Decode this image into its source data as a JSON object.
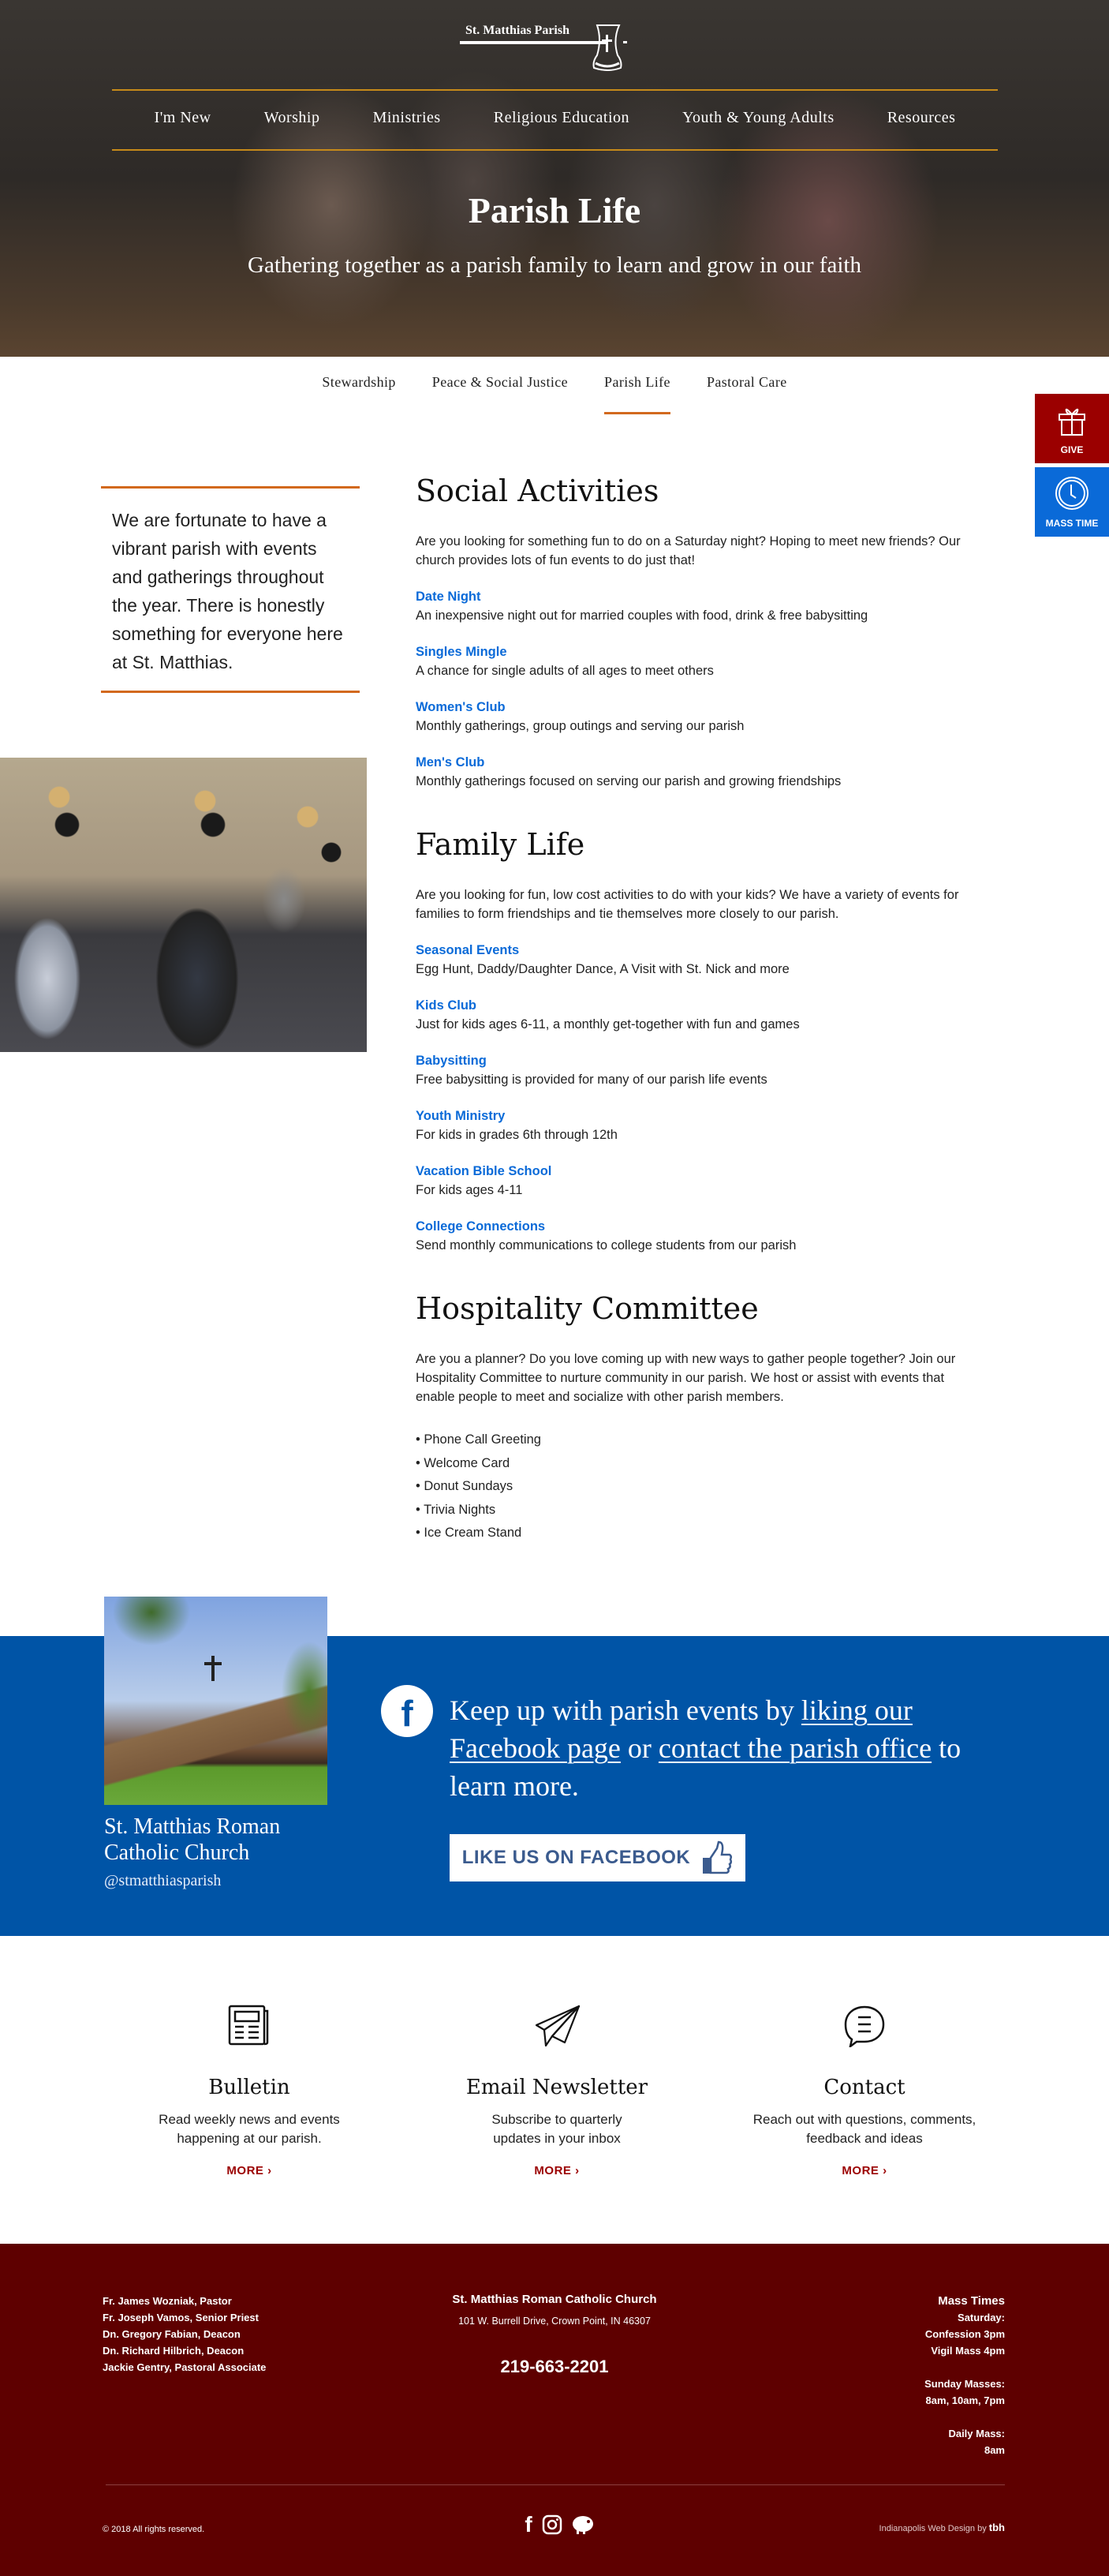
{
  "logo": {
    "text": "St. Matthias Parish"
  },
  "main_nav": [
    "I'm New",
    "Worship",
    "Ministries",
    "Religious Education",
    "Youth & Young Adults",
    "Resources"
  ],
  "hero": {
    "title": "Parish Life",
    "subtitle": "Gathering together as a parish family to learn and grow in our faith"
  },
  "sub_nav": {
    "items": [
      "Stewardship",
      "Peace & Social Justice",
      "Parish Life",
      "Pastoral Care"
    ],
    "active": "Parish Life"
  },
  "side_buttons": {
    "give": "GIVE",
    "mass_time": "MASS TIME"
  },
  "colors": {
    "give": "#9b0000",
    "mass_time": "#0a6ad8",
    "accent": "#d2691e",
    "link": "#0a6ad8",
    "fb_band": "#0054a6",
    "footer": "#5e0000"
  },
  "quote": "We are fortunate to have a vibrant parish with events and gatherings throughout the year. There is honestly something for everyone here at St. Matthias.",
  "sections": [
    {
      "title": "Social Activities",
      "intro": "Are you looking for something fun to do on a Saturday night? Hoping to meet new friends? Our church provides lots of fun events to do just that!",
      "items": [
        {
          "title": "Date Night",
          "desc": "An inexpensive night out for married couples with food, drink & free babysitting"
        },
        {
          "title": "Singles Mingle",
          "desc": "A chance for single adults of all ages to meet others"
        },
        {
          "title": "Women's Club",
          "desc": "Monthly gatherings, group outings and serving our parish"
        },
        {
          "title": "Men's Club",
          "desc": "Monthly gatherings focused on serving our parish and growing friendships"
        }
      ]
    },
    {
      "title": "Family Life",
      "intro": "Are you looking for fun, low cost activities to do with your kids? We have a variety of events for families to form friendships and tie themselves more closely to our parish.",
      "items": [
        {
          "title": "Seasonal Events",
          "desc": "Egg Hunt, Daddy/Daughter Dance, A Visit with St. Nick and more"
        },
        {
          "title": "Kids Club",
          "desc": "Just for kids ages 6-11, a monthly get-together with fun and games"
        },
        {
          "title": "Babysitting",
          "desc": "Free babysitting is provided for many of our parish life events"
        },
        {
          "title": "Youth Ministry",
          "desc": "For kids in grades 6th through 12th"
        },
        {
          "title": "Vacation Bible School",
          "desc": "For kids ages 4-11"
        },
        {
          "title": "College Connections",
          "desc": "Send monthly communications to college students from our parish"
        }
      ]
    },
    {
      "title": "Hospitality Committee",
      "intro": "Are you a planner? Do you love coming up with new ways to gather people together? Join our Hospitality Committee to nurture community in our parish. We host or assist with events that enable people to meet and socialize with other parish members.",
      "bullets": [
        "• Phone Call Greeting",
        "• Welcome Card",
        "• Donut Sundays",
        "• Trivia Nights",
        "• Ice Cream Stand"
      ]
    }
  ],
  "facebook": {
    "church_name": "St. Matthias Roman Catholic Church",
    "handle": "@stmatthiasparish",
    "text_1": "Keep up with parish events by ",
    "link_1": "liking our Facebook page",
    "text_2": " or ",
    "link_2": "contact the parish office",
    "text_3": " to learn more.",
    "button": "LIKE US ON FACEBOOK"
  },
  "cards": [
    {
      "icon": "newspaper-icon",
      "title": "Bulletin",
      "desc": "Read weekly news and events happening at our parish.",
      "more": "MORE ›"
    },
    {
      "icon": "paper-plane-icon",
      "title": "Email Newsletter",
      "desc": "Subscribe to quarterly updates in your inbox",
      "more": "MORE ›"
    },
    {
      "icon": "chat-bubble-icon",
      "title": "Contact",
      "desc": "Reach out with questions, comments, feedback and ideas",
      "more": "MORE ›"
    }
  ],
  "footer": {
    "staff": [
      "Fr. James Wozniak, Pastor",
      "Fr. Joseph Vamos, Senior Priest",
      "Dn. Gregory Fabian, Deacon",
      "Dn. Richard Hilbrich, Deacon",
      "Jackie Gentry, Pastoral Associate"
    ],
    "church_name": "St. Matthias Roman Catholic Church",
    "address": "101 W. Burrell Drive, Crown Point, IN 46307",
    "phone": "219-663-2201",
    "mass_title": "Mass Times",
    "mass_lines": [
      "Saturday:",
      "Confession 3pm",
      "Vigil Mass 4pm",
      "",
      "Sunday Masses:",
      "8am, 10am, 7pm",
      "",
      "Daily Mass:",
      "8am"
    ],
    "copyright": "© 2018 All rights reserved.",
    "credit": "Indianapolis Web Design by",
    "credit_logo": "tbh"
  }
}
